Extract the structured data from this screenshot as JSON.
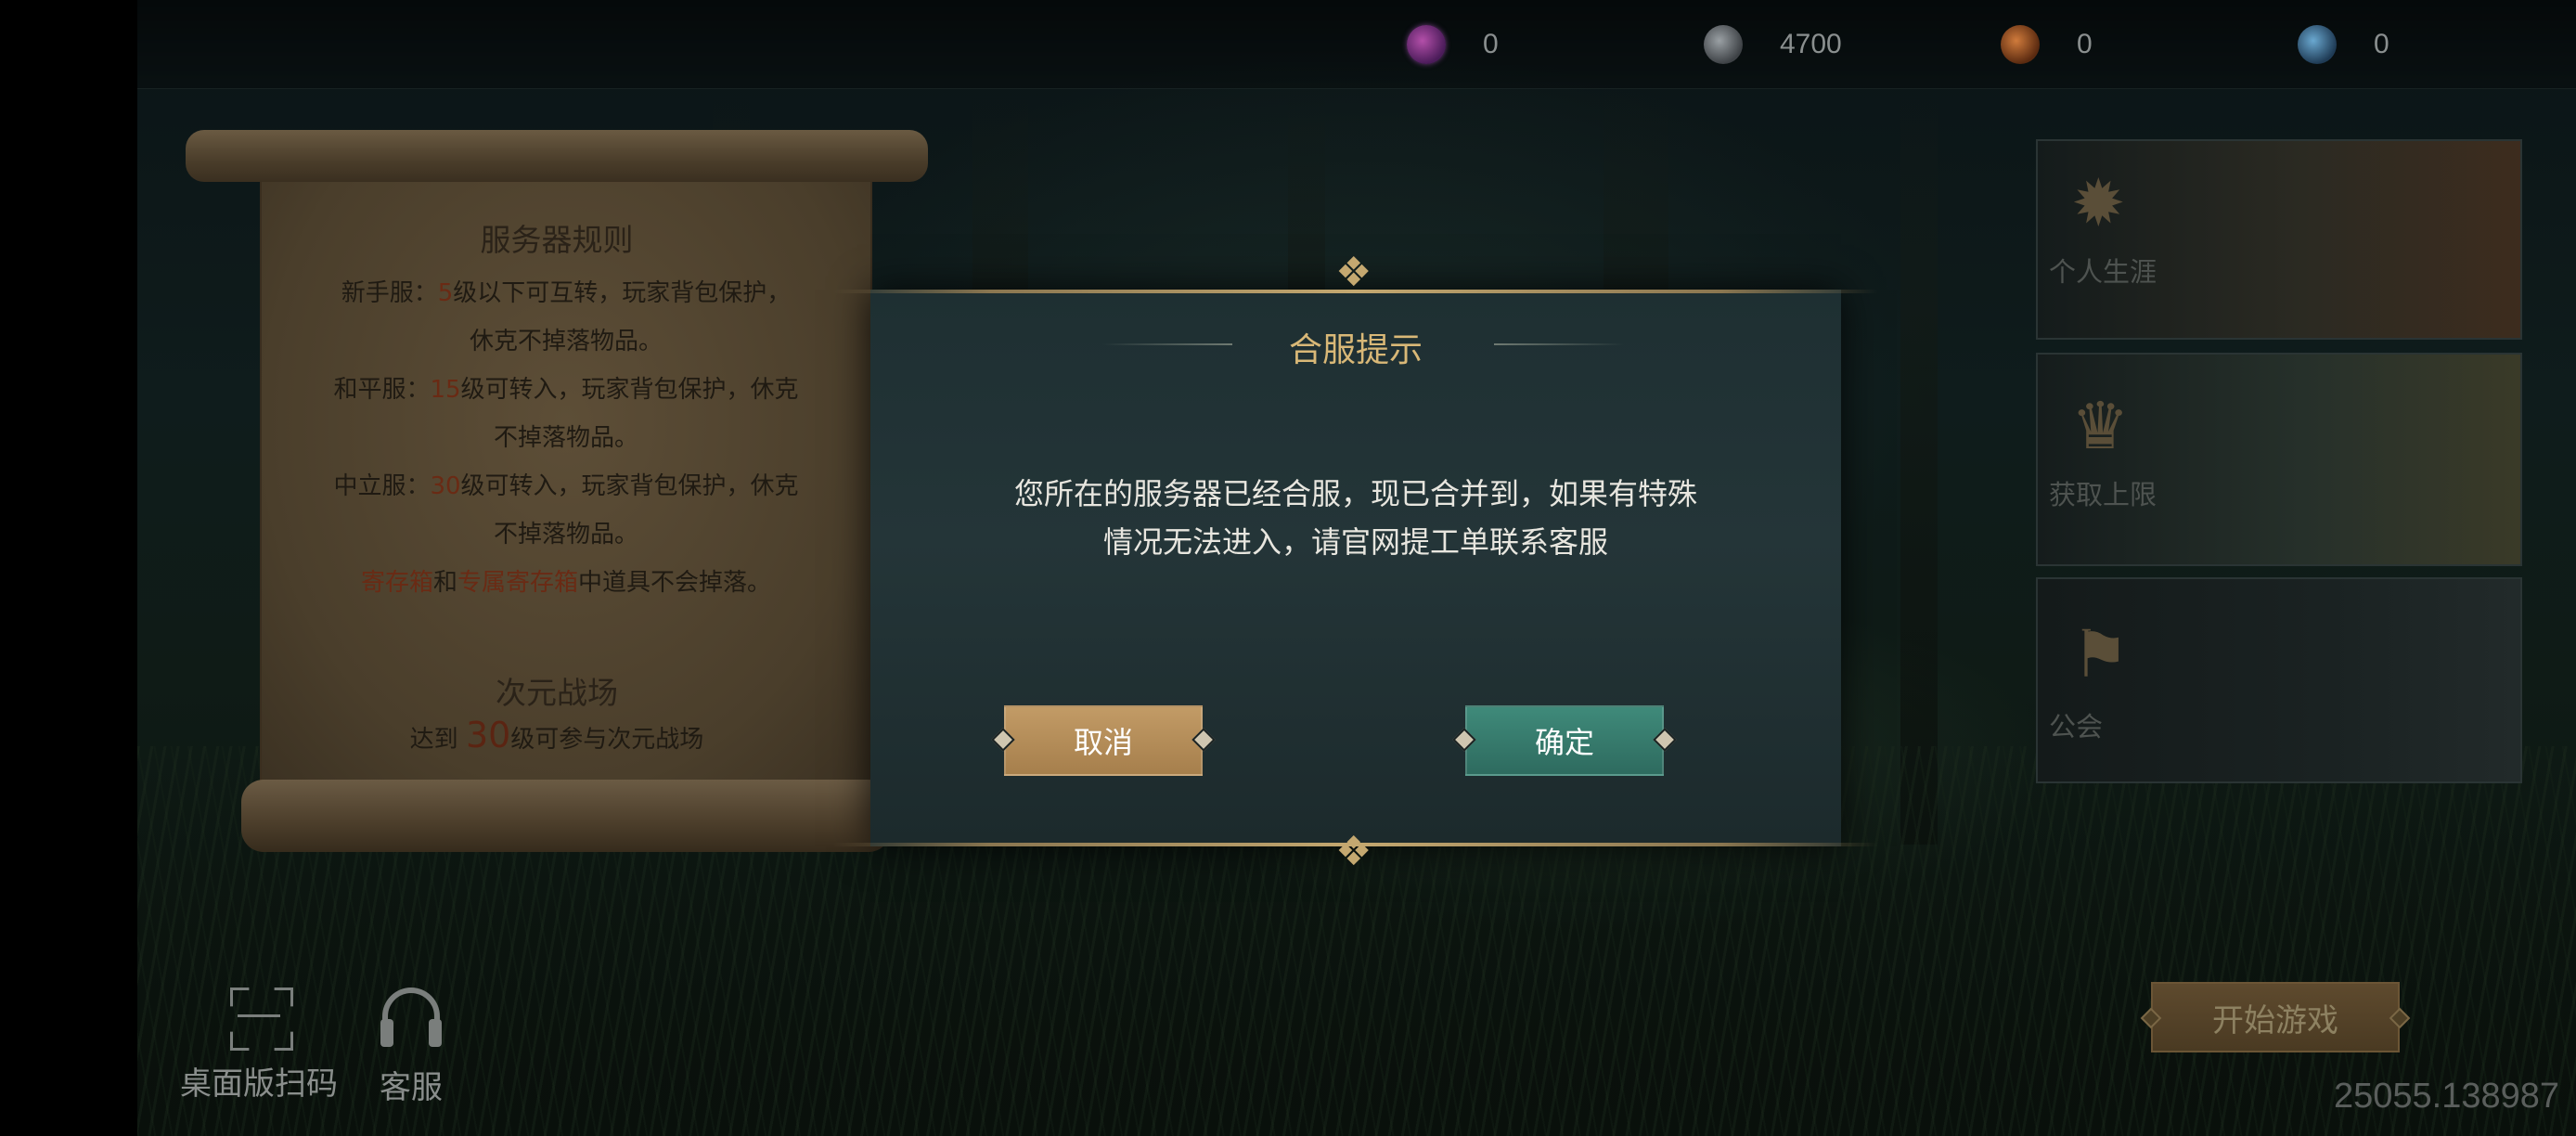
{
  "currencies": [
    {
      "icon": "purple-gem-icon",
      "value": "0"
    },
    {
      "icon": "silver-coin-icon",
      "value": "4700"
    },
    {
      "icon": "orange-coin-icon",
      "value": "0"
    },
    {
      "icon": "blue-gem-icon",
      "value": "0"
    }
  ],
  "scroll": {
    "title": "服务器规则",
    "rule1_a": "新手服：",
    "rule1_num": "5",
    "rule1_b": "级以下可互转，玩家背包保护，",
    "rule1_c": "休克不掉落物品。",
    "rule2_a": "和平服：",
    "rule2_num": "15",
    "rule2_b": "级可转入，玩家背包保护，休克",
    "rule2_c": "不掉落物品。",
    "rule3_a": "中立服：",
    "rule3_num": "30",
    "rule3_b": "级可转入，玩家背包保护，休克",
    "rule3_c": "不掉落物品。",
    "rule4_a": "寄存箱",
    "rule4_b": "和",
    "rule4_c": "专属寄存箱",
    "rule4_d": "中道具不会掉落。",
    "section2_title": "次元战场",
    "section2_a": "达到 ",
    "section2_num": "30",
    "section2_b": "级可参与次元战场"
  },
  "panels": [
    {
      "label": "个人生涯",
      "icon": "sun-emblem-icon"
    },
    {
      "label": "获取上限",
      "icon": "trophy-icon"
    },
    {
      "label": "公会",
      "icon": "banner-icon"
    }
  ],
  "dialog": {
    "title": "合服提示",
    "message_line1": "您所在的服务器已经合服，现已合并到，如果有特殊",
    "message_line2": "情况无法进入，请官网提工单联系客服",
    "cancel_label": "取消",
    "confirm_label": "确定"
  },
  "bottom": {
    "scan_label": "桌面版扫码",
    "service_label": "客服",
    "start_label": "开始游戏",
    "version": "25055.138987"
  },
  "colors": {
    "accent_gold": "#d9b877",
    "confirm_teal": "#3f8a7a",
    "cancel_tan": "#c29b66",
    "highlight_red": "#6a2a14"
  }
}
